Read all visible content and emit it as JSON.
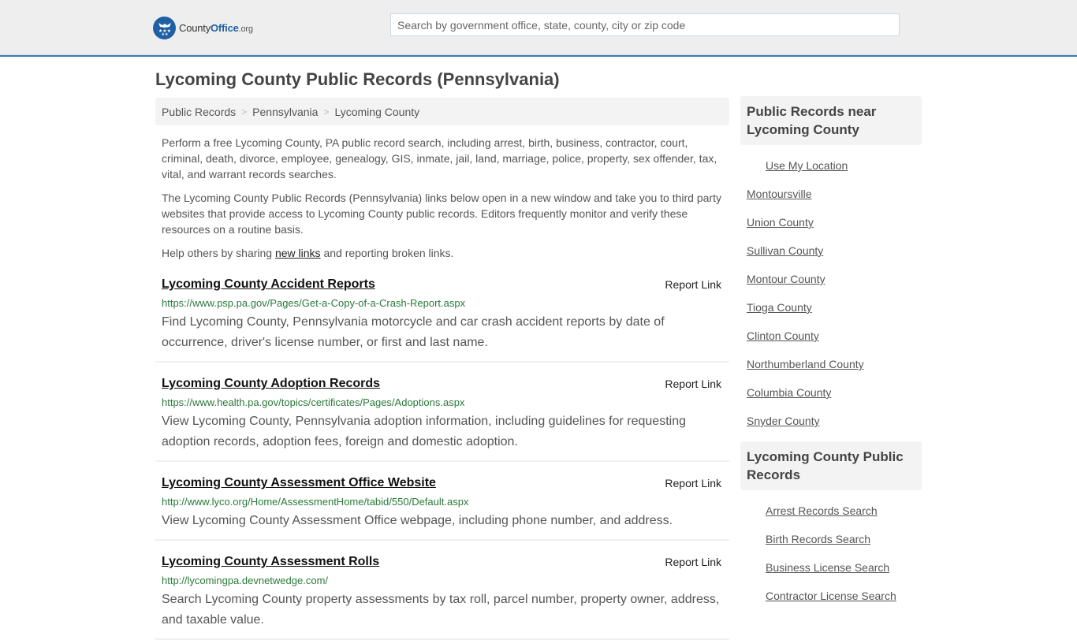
{
  "header": {
    "logo": {
      "name_part1": "County",
      "name_part2": "Office",
      "name_part3": ".org"
    },
    "search_placeholder": "Search by government office, state, county, city or zip code",
    "search_value": ""
  },
  "page": {
    "title": "Lycoming County Public Records (Pennsylvania)"
  },
  "breadcrumb": [
    {
      "label": "Public Records"
    },
    {
      "label": "Pennsylvania"
    },
    {
      "label": "Lycoming County"
    }
  ],
  "breadcrumb_separator": ">",
  "intro": {
    "p1": "Perform a free Lycoming County, PA public record search, including arrest, birth, business, contractor, court, criminal, death, divorce, employee, genealogy, GIS, inmate, jail, land, marriage, police, property, sex offender, tax, vital, and warrant records searches.",
    "p2": "The Lycoming County Public Records (Pennsylvania) links below open in a new window and take you to third party websites that provide access to Lycoming County public records. Editors frequently monitor and verify these resources on a routine basis.",
    "p3_before": "Help others by sharing ",
    "p3_link": "new links",
    "p3_after": " and reporting broken links."
  },
  "records": [
    {
      "title": "Lycoming County Accident Reports",
      "report_label": "Report Link",
      "url": "https://www.psp.pa.gov/Pages/Get-a-Copy-of-a-Crash-Report.aspx",
      "description": "Find Lycoming County, Pennsylvania motorcycle and car crash accident reports by date of occurrence, driver's license number, or first and last name."
    },
    {
      "title": "Lycoming County Adoption Records",
      "report_label": "Report Link",
      "url": "https://www.health.pa.gov/topics/certificates/Pages/Adoptions.aspx",
      "description": "View Lycoming County, Pennsylvania adoption information, including guidelines for requesting adoption records, adoption fees, foreign and domestic adoption."
    },
    {
      "title": "Lycoming County Assessment Office Website",
      "report_label": "Report Link",
      "url": "http://www.lyco.org/Home/AssessmentHome/tabid/550/Default.aspx",
      "description": "View Lycoming County Assessment Office webpage, including phone number, and address."
    },
    {
      "title": "Lycoming County Assessment Rolls",
      "report_label": "Report Link",
      "url": "http://lycomingpa.devnetwedge.com/",
      "description": "Search Lycoming County property assessments by tax roll, parcel number, property owner, address, and taxable value."
    }
  ],
  "sidebar": {
    "nearby": {
      "heading": "Public Records near Lycoming County",
      "use_location": "Use My Location",
      "items": [
        "Montoursville",
        "Union County",
        "Sullivan County",
        "Montour County",
        "Tioga County",
        "Clinton County",
        "Northumberland County",
        "Columbia County",
        "Snyder County"
      ]
    },
    "county_records": {
      "heading": "Lycoming County Public Records",
      "items": [
        "Arrest Records Search",
        "Birth Records Search",
        "Business License Search",
        "Contractor License Search"
      ]
    }
  },
  "colors": {
    "brand_blue": "#1f5fa3",
    "header_border": "#3c7dab",
    "url_green": "#2a7a3a"
  }
}
